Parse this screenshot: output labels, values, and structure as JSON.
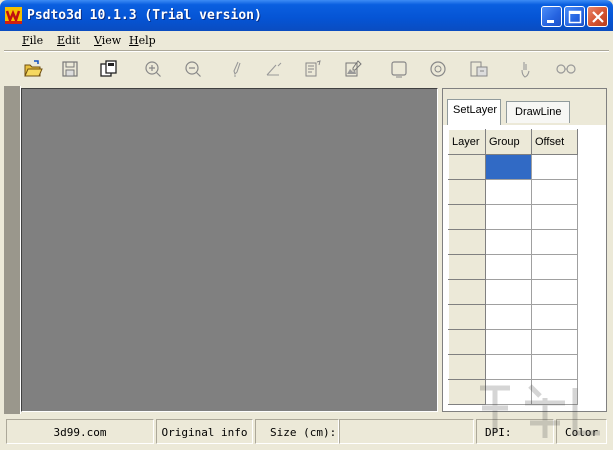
{
  "window": {
    "title": "Psdto3d 10.1.3 (Trial version)",
    "icon": "app-logo-icon",
    "controls": [
      "minimize-icon",
      "maximize-icon",
      "close-icon"
    ]
  },
  "menu": {
    "items": [
      {
        "label": "File"
      },
      {
        "label": "Edit"
      },
      {
        "label": "View"
      },
      {
        "label": "Help"
      }
    ]
  },
  "toolbar": {
    "tools": [
      "open-icon",
      "save-icon",
      "copy-icon",
      "zoom-in-icon",
      "zoom-out-icon",
      "pen-icon",
      "angle-icon",
      "edit-layer-icon",
      "image-edit-icon",
      "frame-icon",
      "target-icon",
      "export-icon",
      "touch-icon",
      "glasses-icon"
    ]
  },
  "panel": {
    "tabs": [
      {
        "label": "SetLayer"
      },
      {
        "label": "DrawLine"
      }
    ],
    "active_tab": "DrawLine",
    "columns": [
      "Layer",
      "Group",
      "Offset"
    ],
    "row_count": 10
  },
  "statusbar": {
    "site": "3d99.com",
    "original_info": "Original info",
    "size_label": "Size (cm):",
    "dpi_label": "DPI:",
    "color_label": "Color"
  },
  "colors": {
    "titlebar": "#0554d4",
    "canvas": "#808080",
    "selection": "#316ac5",
    "chrome": "#ece9d8"
  }
}
